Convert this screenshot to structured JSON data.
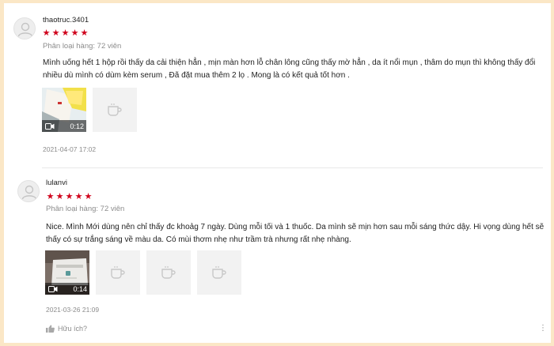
{
  "colors": {
    "background": "#fbe7c6",
    "star": "#d0011b",
    "muted": "#8c8c8c"
  },
  "reviews": [
    {
      "username": "thaotruc.3401",
      "rating": 5,
      "variant": "Phân loại hàng: 72 viên",
      "comment": "Mình uống hết 1 hộp rồi thấy da cải thiện hẳn , mịn màn hơn lỗ chân lông cũng thấy mờ hẳn , da ít nổi mụn , thâm do mụn thì không thấy đổi nhiều dù mình có dùm kèm serum , Đã đặt mua thêm 2 lọ . Mong là có kết quả tốt hơn .",
      "video_duration": "0:12",
      "image_placeholders": 1,
      "date": "2021-04-07 17:02"
    },
    {
      "username": "lulanvi",
      "rating": 5,
      "variant": "Phân loại hàng: 72 viên",
      "comment": "Nice. Mình Mới dùng nên chỉ thấy đc khoảg 7 ngày. Dùng mỗi tối và 1 thuốc. Da mình sẽ mịn hơn sau mỗi sáng thức dậy. Hi vọng dùng hết sẽ thấy có sự trắng sáng về màu da. Có mùi thơm nhẹ như trầm trà nhưng rất nhẹ nhàng.",
      "video_duration": "0:14",
      "image_placeholders": 3,
      "date": "2021-03-26 21:09",
      "helpful_label": "Hữu ích?",
      "more_icon": "more-dots-icon"
    }
  ],
  "icons": {
    "avatar": "user-avatar-icon",
    "video": "video-camera-icon",
    "placeholder": "image-placeholder-icon",
    "helpful": "thumbs-up-icon"
  }
}
